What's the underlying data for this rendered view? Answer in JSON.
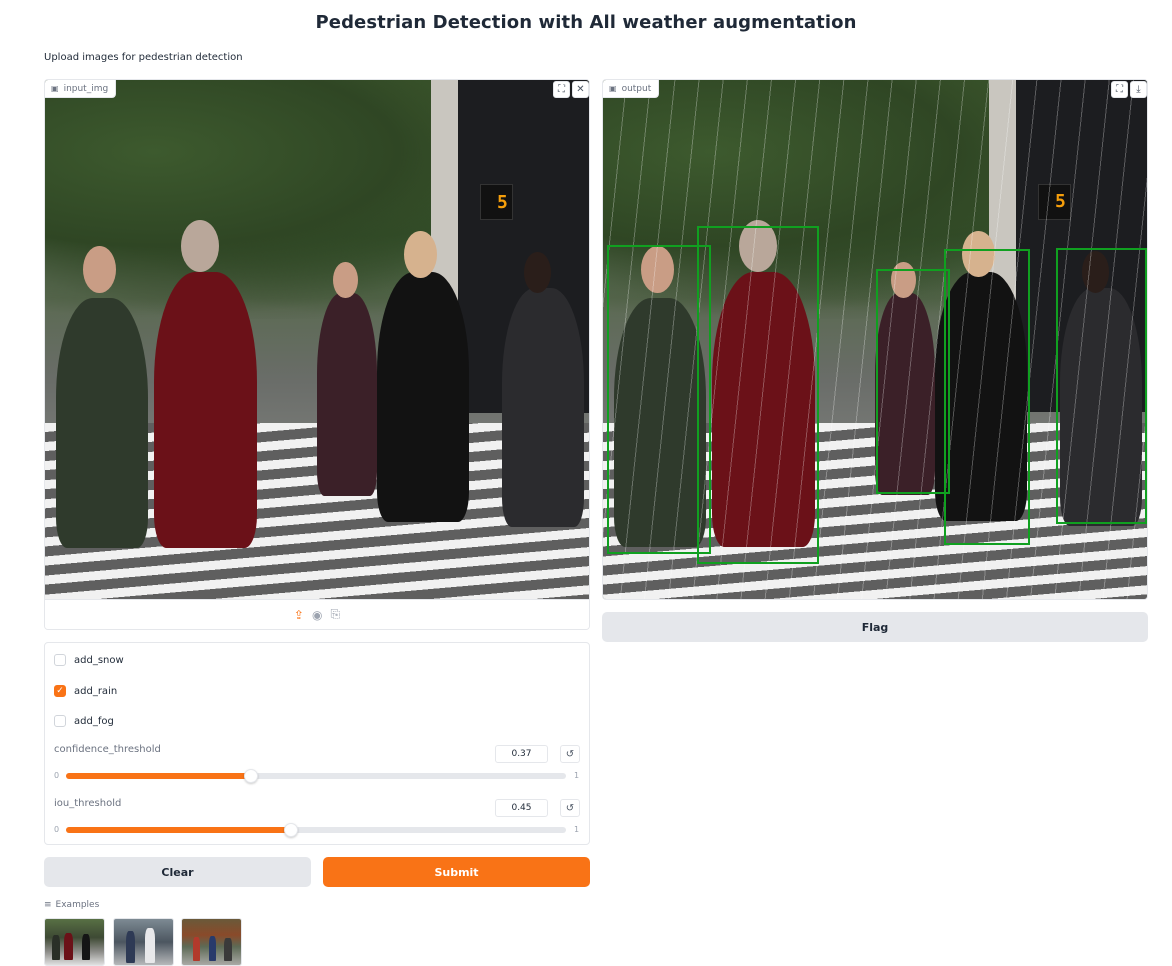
{
  "header": {
    "title": "Pedestrian Detection with All weather augmentation",
    "description": "Upload images for pedestrian detection"
  },
  "input_panel": {
    "label": "input_img",
    "icons": [
      "fullscreen-icon",
      "close-icon"
    ],
    "source_icons": [
      "upload-icon",
      "webcam-icon",
      "clipboard-icon"
    ],
    "sign_text": "5"
  },
  "output_panel": {
    "label": "output",
    "icons": [
      "fullscreen-icon",
      "download-icon"
    ],
    "flag_label": "Flag",
    "detections": 5
  },
  "controls": {
    "checkboxes": [
      {
        "label": "add_snow",
        "checked": false
      },
      {
        "label": "add_rain",
        "checked": true
      },
      {
        "label": "add_fog",
        "checked": false
      }
    ],
    "sliders": [
      {
        "label": "confidence_threshold",
        "value": "0.37",
        "min": "0",
        "max": "1",
        "fraction": 0.37
      },
      {
        "label": "iou_threshold",
        "value": "0.45",
        "min": "0",
        "max": "1",
        "fraction": 0.45
      }
    ],
    "reset_glyph": "↺"
  },
  "actions": {
    "clear_label": "Clear",
    "submit_label": "Submit"
  },
  "examples": {
    "label": "Examples",
    "count": 3
  },
  "colors": {
    "accent": "#f97316",
    "bbox": "#10a020"
  }
}
